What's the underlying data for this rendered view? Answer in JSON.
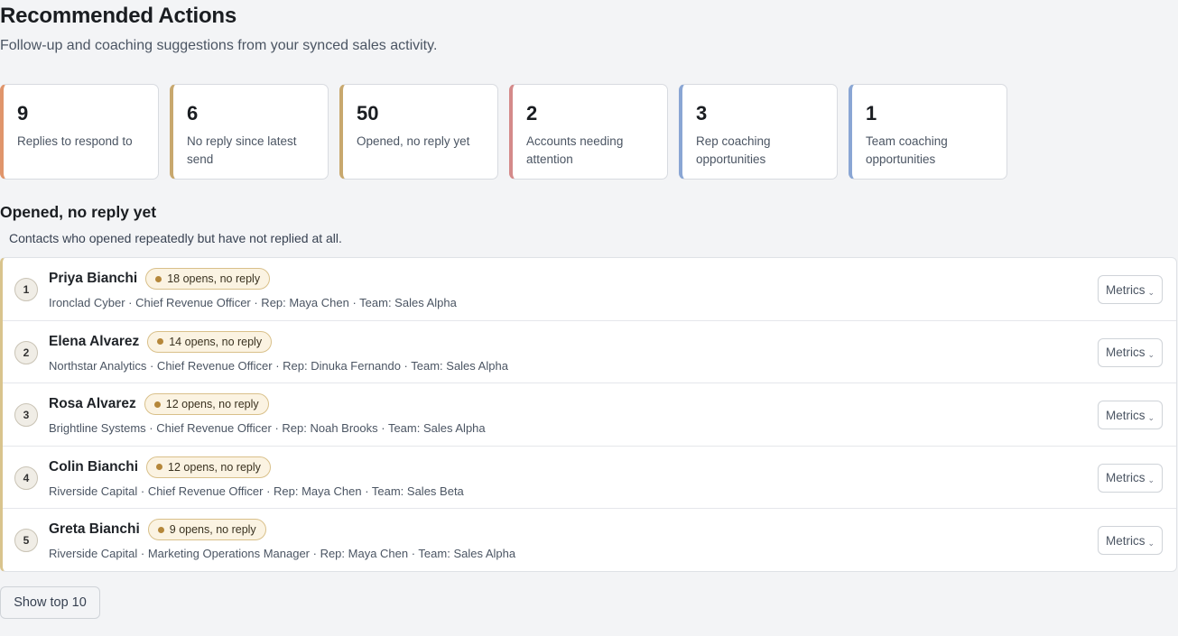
{
  "header": {
    "title": "Recommended Actions",
    "subtitle": "Follow-up and coaching suggestions from your synced sales activity."
  },
  "summary_cards": [
    {
      "value": "9",
      "label": "Replies to respond to",
      "accent": "#e0956b"
    },
    {
      "value": "6",
      "label": "No reply since latest send",
      "accent": "#c8a86e"
    },
    {
      "value": "50",
      "label": "Opened, no reply yet",
      "accent": "#c8a86e"
    },
    {
      "value": "2",
      "label": "Accounts needing attention",
      "accent": "#d48a8a"
    },
    {
      "value": "3",
      "label": "Rep coaching opportunities",
      "accent": "#8aa6d4"
    },
    {
      "value": "1",
      "label": "Team coaching opportunities",
      "accent": "#8aa6d4"
    }
  ],
  "section": {
    "title": "Opened, no reply yet",
    "subtitle": "Contacts who opened repeatedly but have not replied at all.",
    "metrics_label": "Metrics",
    "rows": [
      {
        "rank": "1",
        "name": "Priya Bianchi",
        "badge": "18 opens, no reply",
        "meta": "Ironclad Cyber · Chief Revenue Officer · Rep: Maya Chen · Team: Sales Alpha"
      },
      {
        "rank": "2",
        "name": "Elena Alvarez",
        "badge": "14 opens, no reply",
        "meta": "Northstar Analytics · Chief Revenue Officer · Rep: Dinuka Fernando · Team: Sales Alpha"
      },
      {
        "rank": "3",
        "name": "Rosa Alvarez",
        "badge": "12 opens, no reply",
        "meta": "Brightline Systems · Chief Revenue Officer · Rep: Noah Brooks · Team: Sales Alpha"
      },
      {
        "rank": "4",
        "name": "Colin Bianchi",
        "badge": "12 opens, no reply",
        "meta": "Riverside Capital · Chief Revenue Officer · Rep: Maya Chen · Team: Sales Beta"
      },
      {
        "rank": "5",
        "name": "Greta Bianchi",
        "badge": "9 opens, no reply",
        "meta": "Riverside Capital · Marketing Operations Manager · Rep: Maya Chen · Team: Sales Alpha"
      }
    ]
  },
  "footer": {
    "show_more_label": "Show top 10"
  },
  "icons": {
    "metrics_chevron": "chevron-down-icon"
  }
}
